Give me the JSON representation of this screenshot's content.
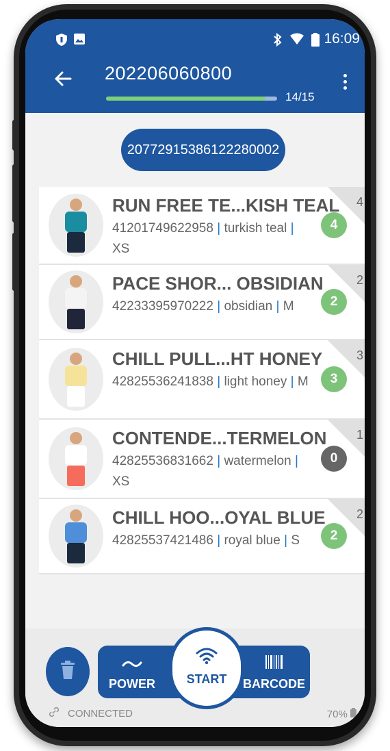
{
  "status_bar": {
    "time": "16:09"
  },
  "header": {
    "title": "202206060800",
    "progress_text": "14/15",
    "progress_fraction": 0.9333
  },
  "scan_code": "20772915386122280002",
  "items": [
    {
      "title": "RUN FREE TE...KISH TEAL",
      "code": "41201749622958",
      "color": "turkish teal",
      "size": "XS",
      "expected": "4",
      "scanned": "4",
      "scanned_color": "#7ec37a",
      "shirt": "#1a8ea0",
      "pants": "#1c2a3d"
    },
    {
      "title": "PACE SHOR... OBSIDIAN",
      "code": "42233395970222",
      "color": "obsidian",
      "size": "M",
      "expected": "2",
      "scanned": "2",
      "scanned_color": "#7ec37a",
      "shirt": "#f4f4f4",
      "pants": "#20253a"
    },
    {
      "title": "CHILL PULL...HT HONEY",
      "code": "42825536241838",
      "color": "light honey",
      "size": "M",
      "expected": "3",
      "scanned": "3",
      "scanned_color": "#7ec37a",
      "shirt": "#f6e39a",
      "pants": "#ffffff"
    },
    {
      "title": "CONTENDE...TERMELON",
      "code": "42825536831662",
      "color": "watermelon",
      "size": "XS",
      "expected": "1",
      "scanned": "0",
      "scanned_color": "#666666",
      "shirt": "#ffffff",
      "pants": "#f56b5c"
    },
    {
      "title": "CHILL HOO...OYAL BLUE",
      "code": "42825537421486",
      "color": "royal blue",
      "size": "S",
      "expected": "2",
      "scanned": "2",
      "scanned_color": "#7ec37a",
      "shirt": "#4f8ed8",
      "pants": "#1c2a3d"
    }
  ],
  "toolbar": {
    "power_label": "POWER",
    "start_label": "START",
    "barcode_label": "BARCODE"
  },
  "footer": {
    "connection": "CONNECTED",
    "battery": "70%"
  },
  "colors": {
    "primary": "#1e56a0",
    "progress": "#7ed07a",
    "success": "#7ec37a",
    "neutral": "#666666"
  }
}
